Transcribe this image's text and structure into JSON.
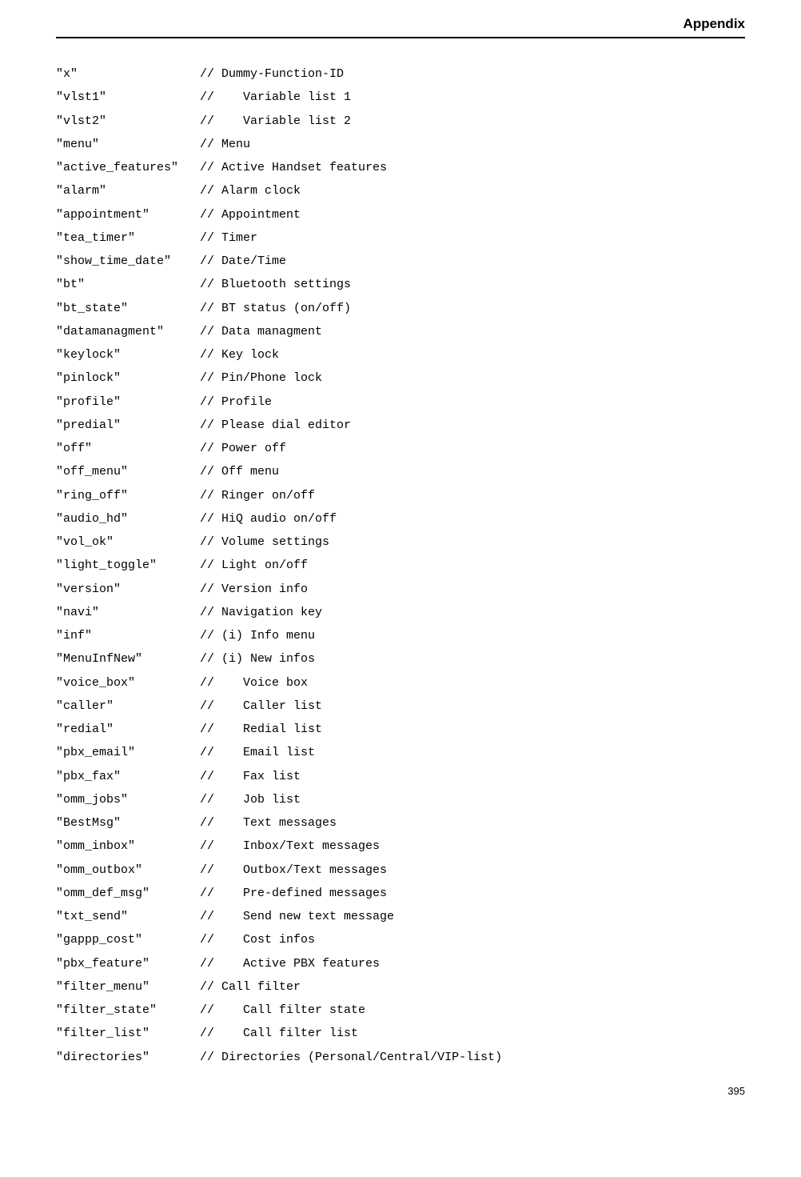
{
  "header": "Appendix",
  "page_number": "395",
  "rows": [
    {
      "key": "\"x\"",
      "comment": "// Dummy-Function-ID"
    },
    {
      "key": "\"vlst1\"",
      "comment": "//    Variable list 1"
    },
    {
      "key": "\"vlst2\"",
      "comment": "//    Variable list 2"
    },
    {
      "key": "\"menu\"",
      "comment": "// Menu"
    },
    {
      "key": "\"active_features\"",
      "comment": "// Active Handset features"
    },
    {
      "key": "\"alarm\"",
      "comment": "// Alarm clock"
    },
    {
      "key": "\"appointment\"",
      "comment": "// Appointment"
    },
    {
      "key": "\"tea_timer\"",
      "comment": "// Timer"
    },
    {
      "key": "\"show_time_date\"",
      "comment": "// Date/Time"
    },
    {
      "key": "\"bt\"",
      "comment": "// Bluetooth settings"
    },
    {
      "key": "\"bt_state\"",
      "comment": "// BT status (on/off)"
    },
    {
      "key": "\"datamanagment\"",
      "comment": "// Data managment"
    },
    {
      "key": "\"keylock\"",
      "comment": "// Key lock"
    },
    {
      "key": "\"pinlock\"",
      "comment": "// Pin/Phone lock"
    },
    {
      "key": "\"profile\"",
      "comment": "// Profile"
    },
    {
      "key": "\"predial\"",
      "comment": "// Please dial editor"
    },
    {
      "key": "\"off\"",
      "comment": "// Power off"
    },
    {
      "key": "\"off_menu\"",
      "comment": "// Off menu"
    },
    {
      "key": "\"ring_off\"",
      "comment": "// Ringer on/off"
    },
    {
      "key": "\"audio_hd\"",
      "comment": "// HiQ audio on/off"
    },
    {
      "key": "\"vol_ok\"",
      "comment": "// Volume settings"
    },
    {
      "key": "\"light_toggle\"",
      "comment": "// Light on/off"
    },
    {
      "key": "\"version\"",
      "comment": "// Version info"
    },
    {
      "key": "\"navi\"",
      "comment": "// Navigation key"
    },
    {
      "key": "\"inf\"",
      "comment": "// (i) Info menu"
    },
    {
      "key": "\"MenuInfNew\"",
      "comment": "// (i) New infos"
    },
    {
      "key": "\"voice_box\"",
      "comment": "//    Voice box"
    },
    {
      "key": "\"caller\"",
      "comment": "//    Caller list"
    },
    {
      "key": "\"redial\"",
      "comment": "//    Redial list"
    },
    {
      "key": "\"pbx_email\"",
      "comment": "//    Email list"
    },
    {
      "key": "\"pbx_fax\"",
      "comment": "//    Fax list"
    },
    {
      "key": "\"omm_jobs\"",
      "comment": "//    Job list"
    },
    {
      "key": "\"BestMsg\"",
      "comment": "//    Text messages"
    },
    {
      "key": "\"omm_inbox\"",
      "comment": "//    Inbox/Text messages"
    },
    {
      "key": "\"omm_outbox\"",
      "comment": "//    Outbox/Text messages"
    },
    {
      "key": "\"omm_def_msg\"",
      "comment": "//    Pre-defined messages"
    },
    {
      "key": "\"txt_send\"",
      "comment": "//    Send new text message"
    },
    {
      "key": "\"gappp_cost\"",
      "comment": "//    Cost infos"
    },
    {
      "key": "\"pbx_feature\"",
      "comment": "//    Active PBX features"
    },
    {
      "key": "\"filter_menu\"",
      "comment": "// Call filter"
    },
    {
      "key": "\"filter_state\"",
      "comment": "//    Call filter state"
    },
    {
      "key": "\"filter_list\"",
      "comment": "//    Call filter list"
    },
    {
      "key": "\"directories\"",
      "comment": "// Directories (Personal/Central/VIP-list)"
    }
  ]
}
